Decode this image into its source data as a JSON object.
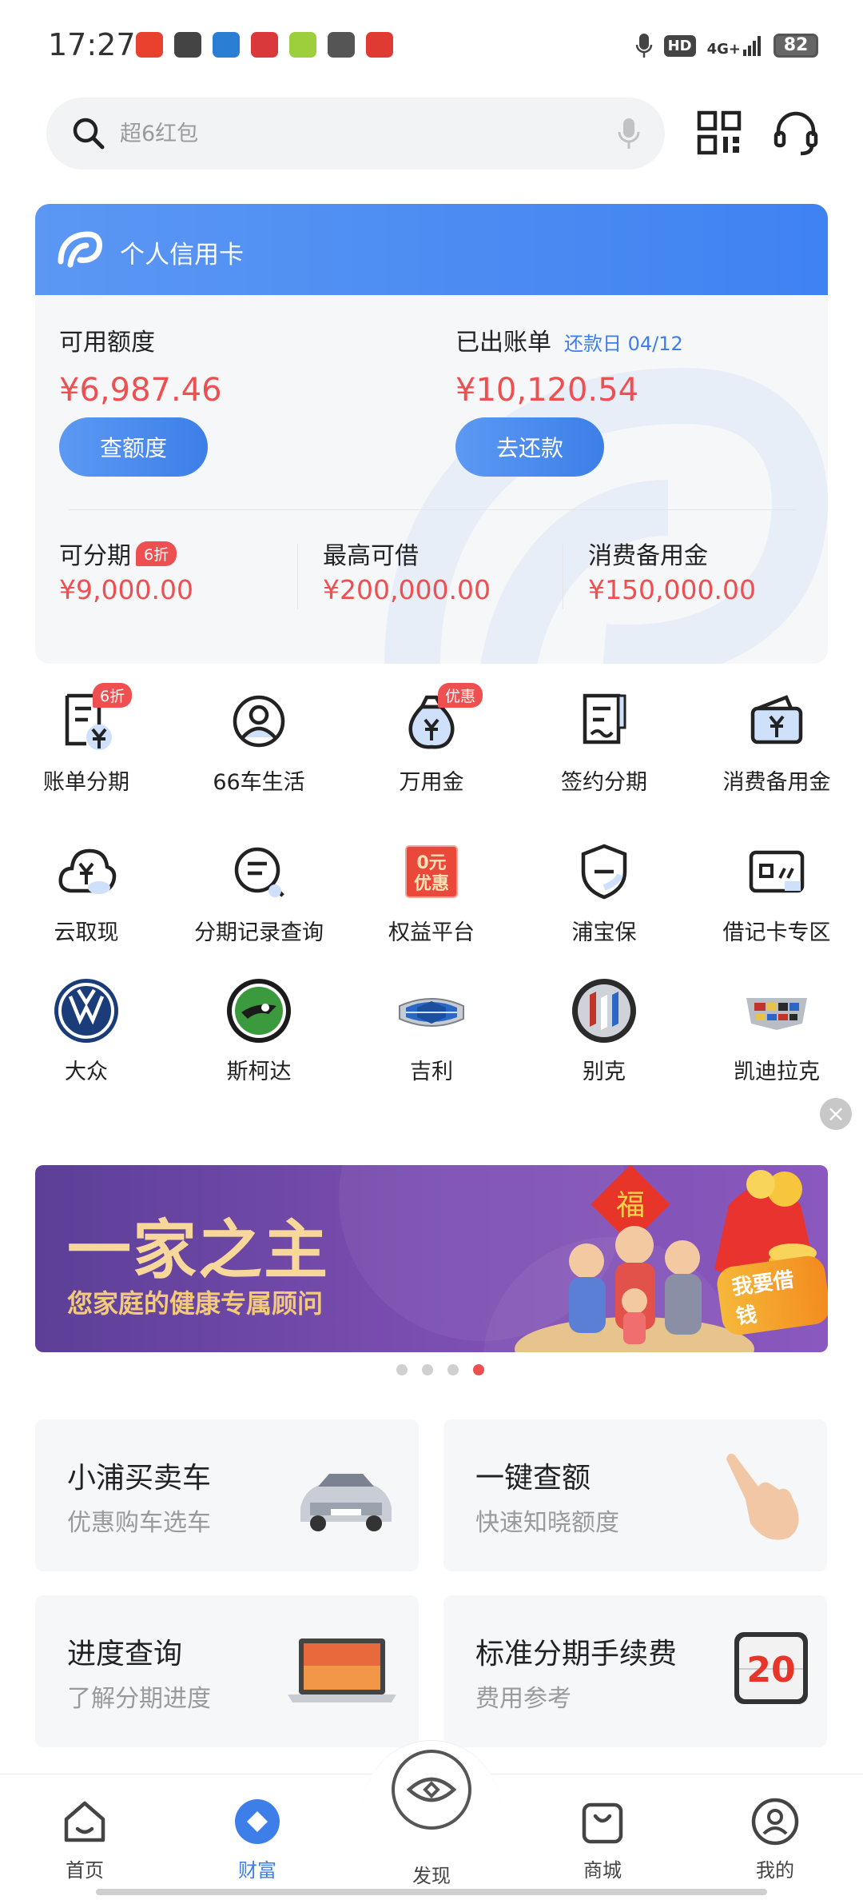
{
  "status_bar": {
    "time": "17:27",
    "hd": "HD",
    "network": "4G+",
    "battery": "82",
    "app_icons": [
      "#e8412e",
      "#444444",
      "#2a7fd4",
      "#d9393b",
      "#9ccf3b",
      "#555555",
      "#e03b33"
    ]
  },
  "search": {
    "placeholder": "超6红包"
  },
  "card": {
    "title": "个人信用卡",
    "available_label": "可用额度",
    "available_amount": "¥6,987.46",
    "check_button": "查额度",
    "billed_label": "已出账单",
    "due_label": "还款日 04/12",
    "billed_amount": "¥10,120.54",
    "repay_button": "去还款",
    "sub": [
      {
        "label": "可分期",
        "badge": "6折",
        "value": "¥9,000.00"
      },
      {
        "label": "最高可借",
        "badge": "",
        "value": "¥200,000.00"
      },
      {
        "label": "消费备用金",
        "badge": "",
        "value": "¥150,000.00"
      }
    ]
  },
  "services": [
    {
      "label": "账单分期",
      "icon": "bill-installment-icon",
      "badge": "6折"
    },
    {
      "label": "66车生活",
      "icon": "car-life-icon",
      "badge": ""
    },
    {
      "label": "万用金",
      "icon": "money-bag-icon",
      "badge": "优惠"
    },
    {
      "label": "签约分期",
      "icon": "contract-icon",
      "badge": ""
    },
    {
      "label": "消费备用金",
      "icon": "wallet-icon",
      "badge": ""
    },
    {
      "label": "云取现",
      "icon": "cloud-cash-icon",
      "badge": ""
    },
    {
      "label": "分期记录查询",
      "icon": "record-search-icon",
      "badge": ""
    },
    {
      "label": "权益平台",
      "icon": "benefit-icon",
      "badge": "",
      "icon_text_1": "0元",
      "icon_text_2": "优惠"
    },
    {
      "label": "浦宝保",
      "icon": "shield-icon",
      "badge": ""
    },
    {
      "label": "借记卡专区",
      "icon": "debit-card-icon",
      "badge": ""
    },
    {
      "label": "大众",
      "icon": "volkswagen-logo-icon",
      "badge": ""
    },
    {
      "label": "斯柯达",
      "icon": "skoda-logo-icon",
      "badge": ""
    },
    {
      "label": "吉利",
      "icon": "geely-logo-icon",
      "badge": ""
    },
    {
      "label": "别克",
      "icon": "buick-logo-icon",
      "badge": ""
    },
    {
      "label": "凯迪拉克",
      "icon": "cadillac-logo-icon",
      "badge": ""
    }
  ],
  "close_glyph": "×",
  "banner": {
    "title": "一家之主",
    "subtitle": "您家庭的健康专属顾问",
    "cta": "我要借钱",
    "fu": "福",
    "slides": 4,
    "active_slide": 4
  },
  "tiles": [
    {
      "title": "小浦买卖车",
      "subtitle": "优惠购车选车",
      "icon": "car-photo-icon"
    },
    {
      "title": "一键查额",
      "subtitle": "快速知晓额度",
      "icon": "finger-tap-icon"
    },
    {
      "title": "进度查询",
      "subtitle": "了解分期进度",
      "icon": "laptop-icon"
    },
    {
      "title": "标准分期手续费",
      "subtitle": "费用参考",
      "icon": "calendar-icon",
      "calendar_number": "20"
    }
  ],
  "nav": {
    "home": "首页",
    "wealth": "财富",
    "discover": "发现",
    "mall": "商城",
    "mine": "我的"
  },
  "colors": {
    "accent_blue": "#3d7ee8",
    "amount_red": "#ee4f50"
  }
}
